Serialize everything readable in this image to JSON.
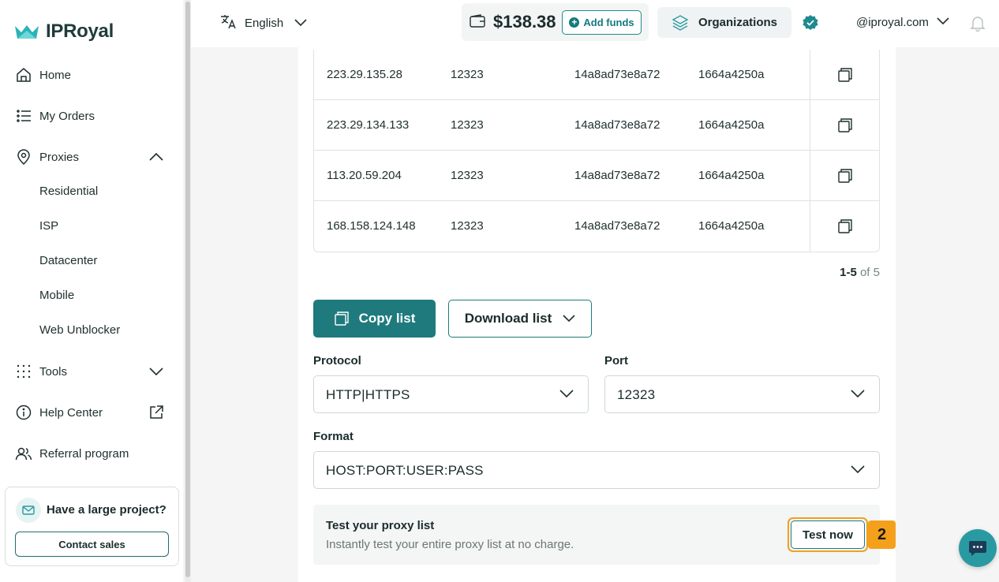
{
  "brand": {
    "name": "IPRoyal",
    "color": "#2bb3b8"
  },
  "sidebar": {
    "items": [
      {
        "label": "Home",
        "icon": "home-icon"
      },
      {
        "label": "My Orders",
        "icon": "list-icon"
      },
      {
        "label": "Proxies",
        "icon": "location-pin-icon",
        "expanded": true
      },
      {
        "label": "Tools",
        "icon": "grid-dots-icon",
        "expanded": false
      },
      {
        "label": "Help Center",
        "icon": "info-icon"
      },
      {
        "label": "Referral program",
        "icon": "users-icon"
      }
    ],
    "proxy_subitems": [
      "Residential",
      "ISP",
      "Datacenter",
      "Mobile",
      "Web Unblocker"
    ],
    "promo": {
      "title": "Have a large project?",
      "button": "Contact sales"
    }
  },
  "topbar": {
    "language": "English",
    "balance": "$138.38",
    "add_funds": "Add funds",
    "organizations": "Organizations",
    "account": "@iproyal.com"
  },
  "table": {
    "rows": [
      {
        "ip": "223.29.135.28",
        "port": "12323",
        "user": "14a8ad73e8a72",
        "pass": "1664a4250a"
      },
      {
        "ip": "223.29.134.133",
        "port": "12323",
        "user": "14a8ad73e8a72",
        "pass": "1664a4250a"
      },
      {
        "ip": "113.20.59.204",
        "port": "12323",
        "user": "14a8ad73e8a72",
        "pass": "1664a4250a"
      },
      {
        "ip": "168.158.124.148",
        "port": "12323",
        "user": "14a8ad73e8a72",
        "pass": "1664a4250a"
      }
    ],
    "pager_range": "1-5",
    "pager_total": "of 5"
  },
  "actions": {
    "copy_list": "Copy list",
    "download_list": "Download list"
  },
  "form": {
    "protocol_label": "Protocol",
    "protocol_value": "HTTP|HTTPS",
    "port_label": "Port",
    "port_value": "12323",
    "format_label": "Format",
    "format_value": "HOST:PORT:USER:PASS"
  },
  "test": {
    "title": "Test your proxy list",
    "subtitle": "Instantly test your entire proxy list at no charge.",
    "button": "Test now",
    "step_badge": "2"
  },
  "colors": {
    "primary": "#1f7a7e",
    "highlight": "#f5a01a",
    "chat": "#2a9aa2"
  }
}
